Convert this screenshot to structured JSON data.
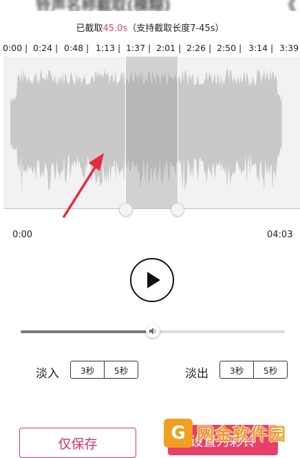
{
  "header": {
    "blurred_title": "铃声名称截取(模糊)",
    "blurred_right": "《"
  },
  "clip_info": {
    "prefix": "已截取",
    "duration": "45.0s",
    "suffix": "（支持截取长度7-45s）"
  },
  "timeline": {
    "ticks": [
      "0:00 |",
      "0:24 |",
      "0:48 |",
      "1:13 |",
      "1:37 |",
      "2:01 |",
      "2:26 |",
      "2:50 |",
      "3:14 |",
      "3:39"
    ]
  },
  "waveform": {
    "selection_start_fraction": 0.41,
    "selection_end_fraction": 0.585
  },
  "playback": {
    "start_time": "0:00",
    "end_time": "04:03"
  },
  "volume": {
    "level_fraction": 0.5
  },
  "fade_in": {
    "label": "淡入",
    "options": [
      "3秒",
      "5秒"
    ]
  },
  "fade_out": {
    "label": "淡出",
    "options": [
      "3秒",
      "5秒"
    ]
  },
  "actions": {
    "save_only": "仅保存",
    "set_ringtone": "设置为彩铃"
  },
  "watermark": {
    "text": "网金软件园",
    "logo_glyph": "G"
  },
  "colors": {
    "accent": "#e0455c",
    "primary_button": "#e9406a",
    "watermark": "#f0a020"
  },
  "annotation": {
    "arrow_color": "#e8283c"
  }
}
